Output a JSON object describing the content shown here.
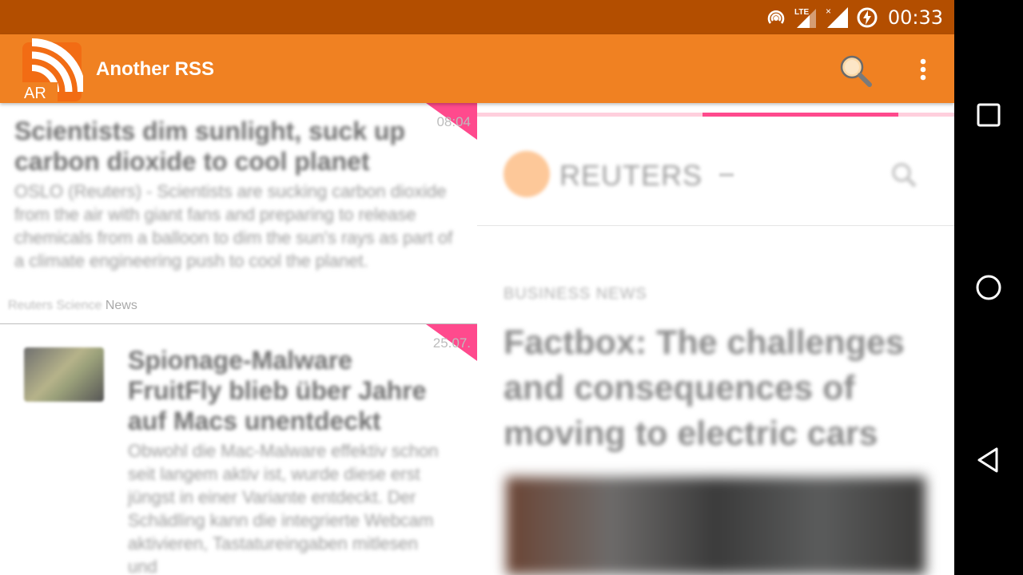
{
  "status": {
    "clock": "00:33",
    "network": "LTE"
  },
  "app": {
    "title": "Another RSS",
    "logo_text": "AR"
  },
  "feed_items": [
    {
      "title": "Scientists dim sunlight, suck up carbon dioxide to cool planet",
      "summary": "OSLO (Reuters) - Scientists are sucking carbon dioxide from the air with giant fans and preparing to release chemicals from a balloon to dim the sun's rays as part of a climate engineering push to cool the planet.",
      "source_blurred": "Reuters Science",
      "source": "News",
      "time": "08:04"
    },
    {
      "title": "Spionage-Malware FruitFly blieb über Jahre auf Macs unentdeckt",
      "summary": "Obwohl die Mac-Malware effektiv schon seit langem aktiv ist, wurde diese erst jüngst in einer Variante entdeckt. Der Schädling kann die integrierte Webcam aktivieren, Tastatureingaben mitlesen und",
      "time": "25.07."
    }
  ],
  "article": {
    "site_name": "REUTERS",
    "kicker": "BUSINESS NEWS",
    "headline": "Factbox: The challenges and consequences of moving to electric cars",
    "progress_pct": 41
  },
  "colors": {
    "appbar": "#f08122",
    "statusbar": "#b34e00",
    "accent": "#ff4a8d"
  }
}
